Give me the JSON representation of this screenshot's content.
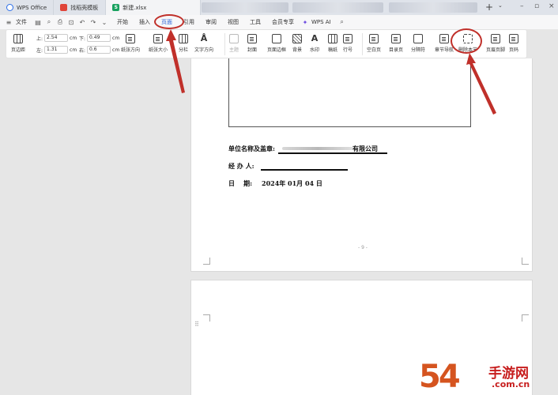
{
  "tabs": [
    {
      "label": "WPS Office"
    },
    {
      "label": "找稻壳模板"
    },
    {
      "label": "新建.xlsx"
    }
  ],
  "file_menu": "文件",
  "menus": [
    "开始",
    "插入",
    "页面",
    "引用",
    "审阅",
    "视图",
    "工具",
    "会员专享"
  ],
  "wps_ai": "WPS AI",
  "ribbon": {
    "margins_label": "页边距",
    "top_label": "上:",
    "top_value": "2.54",
    "bottom_label": "下:",
    "bottom_value": "0.49",
    "left_label": "左:",
    "left_value": "1.31",
    "right_label": "右:",
    "right_value": "0.6",
    "unit": "cm",
    "buttons": [
      "纸张方向",
      "纸张大小",
      "分栏",
      "文字方向",
      "主题",
      "封面",
      "页面边框",
      "背景",
      "水印",
      "稿纸",
      "行号",
      "空白页",
      "目录页",
      "分隔符",
      "章节导航",
      "删除本节",
      "页眉页脚",
      "页码"
    ]
  },
  "document": {
    "company_label": "单位名称及盖章:",
    "company_tail": "有限公司",
    "handler_label": "经 办 人:",
    "date_label": "日    期:",
    "date_value": "2024年 01月 04 日",
    "page_number": "- 9 -"
  },
  "watermark": {
    "big": "54",
    "red": "手游网",
    "small": ".com.cn"
  },
  "colors": {
    "accent": "#2a63d8",
    "annotation": "#c0302a",
    "watermark_orange": "#d5541f",
    "watermark_red": "#c71d1d"
  }
}
